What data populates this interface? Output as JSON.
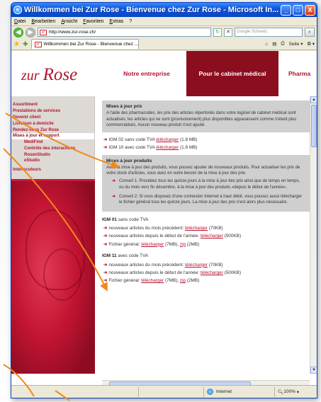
{
  "window": {
    "title": "Willkommen bei Zur Rose - Bienvenue chez Zur Rose - Microsoft In...",
    "min_label": "_",
    "max_label": "□",
    "close_label": "X"
  },
  "menubar": [
    "Datei",
    "Bearbeiten",
    "Ansicht",
    "Favoriten",
    "Extras",
    "?"
  ],
  "address": {
    "url": "http://www.zur-rose.ch/",
    "search_placeholder": "Google Schweiz"
  },
  "tabbar": {
    "tab_label": "Willkommen bei Zur Rose - Bienvenue chez ...",
    "tools": [
      "Seite ▾",
      "❂ ▾"
    ]
  },
  "site": {
    "logo_prefix": "zur",
    "logo_main": "Rose",
    "nav": [
      "Notre entreprise",
      "Pour le cabinet médical",
      "Pharma"
    ]
  },
  "left_menu": [
    {
      "label": "Assortiment",
      "level": "top"
    },
    {
      "label": "Prestations de services",
      "level": "top"
    },
    {
      "label": "Devenir client",
      "level": "top"
    },
    {
      "label": "Livraison à domicile",
      "level": "top"
    },
    {
      "label": "Rendez-vous Zur Rose",
      "level": "top"
    },
    {
      "label": "Mises à jour et support",
      "level": "top",
      "selected": true
    },
    {
      "label": "MediFind",
      "level": "sub"
    },
    {
      "label": "Contrôle des interactions",
      "level": "sub"
    },
    {
      "label": "RosenStudio",
      "level": "sub"
    },
    {
      "label": "eStudio",
      "level": "sub"
    },
    {
      "label": "Interlocuteurs",
      "level": "top",
      "gap": true
    }
  ],
  "prices": {
    "heading": "Mises à jour prix",
    "text": "A l'aide des pharmacodes, les prix des articles répertoriés dans votre logiciel de cabinet médical sont actualisés; les articles qui ne sont (provisoirement) plus disponibles apparaissent comme n'étant plus commercialisés. Aucun nouveau produit n'est ajouté.",
    "downloads": [
      {
        "prefix": "IGM 02 sans code TVA",
        "link": "télécharger",
        "size": "(1.8 MB)"
      },
      {
        "prefix": "IGM 10 avec code TVA",
        "link": "télécharger",
        "size": "(1.6 MB)"
      }
    ]
  },
  "products": {
    "heading": "Mises à jour produits",
    "text": "Avec la mise à jour des produits, vous pouvez ajouter de nouveaux produits. Pour actualiser les prix de votre stock d'articles, vous avez en outre besoin de la mise à jour des prix.",
    "tips": [
      "Conseil 1: Procédez tous les quinze jours à la mise à jour des prix ainsi que de temps en temps, ou du mois vers fin décembre, à la mise à jour des produits »depuis le début de l'année«.",
      "Conseil 2: Si vous disposez d'une connexion Internet à haut débit, vous pouvez aussi télécharger le fichier général tous les quinze jours. La mise à jour des prix n'est alors plus nécessaire."
    ]
  },
  "igm01": {
    "title_bold": "IGM 01",
    "title_rest": "sans code TVA",
    "rows": [
      {
        "text": "nouveaux articles du mois précédent:",
        "links": [
          "télécharger"
        ],
        "tail": "(70KB)"
      },
      {
        "text": "nouveaux articles depuis le début de l'année:",
        "links": [
          "télécharger"
        ],
        "tail": "(500KB)"
      },
      {
        "text": "Fichier général:",
        "links": [
          "télécharger",
          "zip"
        ],
        "mid": "(7MB),",
        "tail": "(2MB)"
      }
    ]
  },
  "igm11": {
    "title_bold": "IGM 11",
    "title_rest": "avec code TVA",
    "rows": [
      {
        "text": "nouveaux articles du mois précédent:",
        "links": [
          "télécharger"
        ],
        "tail": "(70KB)"
      },
      {
        "text": "nouveaux articles depuis le début de l'année:",
        "links": [
          "télécharger"
        ],
        "tail": "(500KB)"
      },
      {
        "text": "Fichier général:",
        "links": [
          "télécharger",
          "zip"
        ],
        "mid": "(7MB),",
        "tail": "(2MB)"
      }
    ]
  },
  "statusbar": {
    "zone": "Internet",
    "zoom": "100%"
  },
  "colors": {
    "brand": "#b3132d",
    "nav_active": "#8b0e1f",
    "annotation": "#f08a1c"
  }
}
